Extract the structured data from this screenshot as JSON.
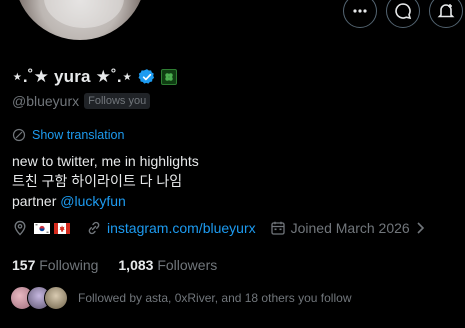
{
  "profile": {
    "display_name": "⋆.˚★ yura ★˚.⋆",
    "handle": "@blueyurx",
    "follows_you_label": "Follows you",
    "show_translation": "Show translation",
    "bio_lines": [
      "new to twitter, me in highlights",
      "트친 구함 하이라이트 다 나임"
    ],
    "partner_label": "partner",
    "partner_mention": "@luckyfun",
    "website": "instagram.com/blueyurx",
    "joined": "Joined March 2026",
    "following_count": "157",
    "following_label": "Following",
    "followers_count": "1,083",
    "followers_label": "Followers",
    "followed_by": "Followed by asta, 0xRiver, and 18 others you follow"
  },
  "icons": {
    "more": "more-icon",
    "message": "message-icon",
    "notifications": "bell-plus-icon",
    "verified": "verified-badge-icon",
    "translate": "translate-icon",
    "location": "location-pin-icon",
    "link": "link-icon",
    "calendar": "calendar-icon"
  },
  "colors": {
    "accent": "#1d9bf0",
    "background": "#000000",
    "text": "#e7e9ea",
    "muted": "#71767b"
  }
}
